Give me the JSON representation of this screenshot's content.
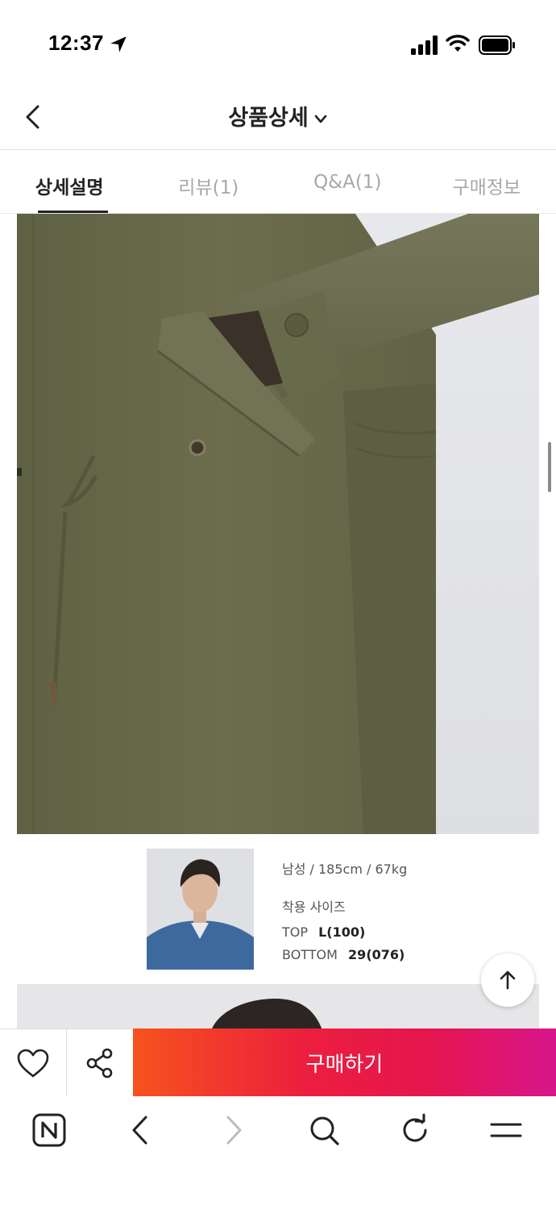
{
  "status_bar": {
    "time": "12:37",
    "icons": [
      "location-arrow-icon",
      "cellular-signal-icon",
      "wifi-icon",
      "battery-icon"
    ]
  },
  "header": {
    "title": "상품상세",
    "back_icon": "chevron-left-icon",
    "title_dropdown_icon": "chevron-down-icon"
  },
  "tabs": [
    {
      "label": "상세설명",
      "active": true
    },
    {
      "label": "리뷰(1)",
      "active": false
    },
    {
      "label": "Q&A(1)",
      "active": false
    },
    {
      "label": "구매정보",
      "active": false
    }
  ],
  "model": {
    "stats": "남성 / 185cm / 67kg",
    "fit_heading": "착용 사이즈",
    "sizes": [
      {
        "label": "TOP",
        "value": "L(100)"
      },
      {
        "label": "BOTTOM",
        "value": "29(076)"
      }
    ]
  },
  "scroll_top_icon": "arrow-up-icon",
  "action_bar": {
    "like_icon": "heart-icon",
    "share_icon": "share-icon",
    "buy_label": "구매하기"
  },
  "browser_bar": {
    "icons": [
      "naver-home-icon",
      "back-icon",
      "forward-icon",
      "search-icon",
      "reload-icon",
      "menu-icon"
    ]
  },
  "colors": {
    "buy_gradient_start": "#f6531c",
    "buy_gradient_end": "#d8168c",
    "coat_olive": "#6b6c4c",
    "active_tab": "#222222",
    "inactive_tab": "#a8a8a8"
  }
}
